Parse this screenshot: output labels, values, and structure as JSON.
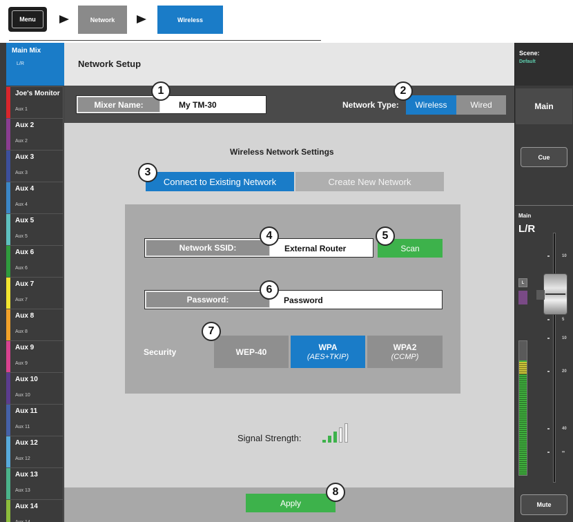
{
  "breadcrumb": {
    "menu": "Menu",
    "network": "Network",
    "wireless": "Wireless"
  },
  "sidebar": {
    "main": {
      "title": "Main Mix",
      "sub": "L/R"
    },
    "items": [
      {
        "name": "Joe's Monitor",
        "sub": "Aux 1",
        "color": "#d9262c"
      },
      {
        "name": "Aux 2",
        "sub": "Aux 2",
        "color": "#8a3d91"
      },
      {
        "name": "Aux 3",
        "sub": "Aux 3",
        "color": "#3c4f9c"
      },
      {
        "name": "Aux 4",
        "sub": "Aux 4",
        "color": "#3b86c6"
      },
      {
        "name": "Aux 5",
        "sub": "Aux 5",
        "color": "#5ec0bf"
      },
      {
        "name": "Aux 6",
        "sub": "Aux 6",
        "color": "#2f9b3d"
      },
      {
        "name": "Aux 7",
        "sub": "Aux 7",
        "color": "#f2e530"
      },
      {
        "name": "Aux 8",
        "sub": "Aux 8",
        "color": "#f2a12a"
      },
      {
        "name": "Aux 9",
        "sub": "Aux 9",
        "color": "#d8428f"
      },
      {
        "name": "Aux 10",
        "sub": "Aux 10",
        "color": "#5b3c8e"
      },
      {
        "name": "Aux 11",
        "sub": "Aux 11",
        "color": "#4561a8"
      },
      {
        "name": "Aux 12",
        "sub": "Aux 12",
        "color": "#57aadb"
      },
      {
        "name": "Aux 13",
        "sub": "Aux 13",
        "color": "#4bb38a"
      },
      {
        "name": "Aux 14",
        "sub": "Aux 14",
        "color": "#8dbd3c"
      }
    ]
  },
  "header": {
    "title": "Network Setup"
  },
  "mixer": {
    "label": "Mixer Name:",
    "value": "My TM-30"
  },
  "network_type": {
    "label": "Network Type:",
    "wireless": "Wireless",
    "wired": "Wired",
    "selected": "Wireless"
  },
  "wireless": {
    "title": "Wireless Network Settings",
    "connect_label": "Connect to Existing Network",
    "create_label": "Create New Network",
    "ssid_label": "Network SSID:",
    "ssid_value": "External Router",
    "scan_label": "Scan",
    "password_label": "Password:",
    "password_value": "Password",
    "security_label": "Security",
    "wep_label": "WEP-40",
    "wpa_label": "WPA",
    "wpa_sub": "(AES+TKIP)",
    "wpa2_label": "WPA2",
    "wpa2_sub": "(CCMP)",
    "selected_security": "WPA"
  },
  "signal": {
    "label": "Signal Strength:",
    "bars_lit": 3,
    "bars_total": 5
  },
  "apply_label": "Apply",
  "callouts": [
    "1",
    "2",
    "3",
    "4",
    "5",
    "6",
    "7",
    "8"
  ],
  "right_panel": {
    "scene_label": "Scene:",
    "scene_value": "Default",
    "main_label": "Main",
    "cue_label": "Cue",
    "fader_title": "Main",
    "fader_sub": "L/R",
    "meter_l": "L",
    "scale": [
      "10",
      "5",
      "10",
      "20",
      "40",
      "∞"
    ],
    "mute_label": "Mute"
  },
  "colors": {
    "accent_blue": "#1a7cc8",
    "green": "#3db24b",
    "dark": "#4a4a4a",
    "panel": "#d4d4d4"
  }
}
